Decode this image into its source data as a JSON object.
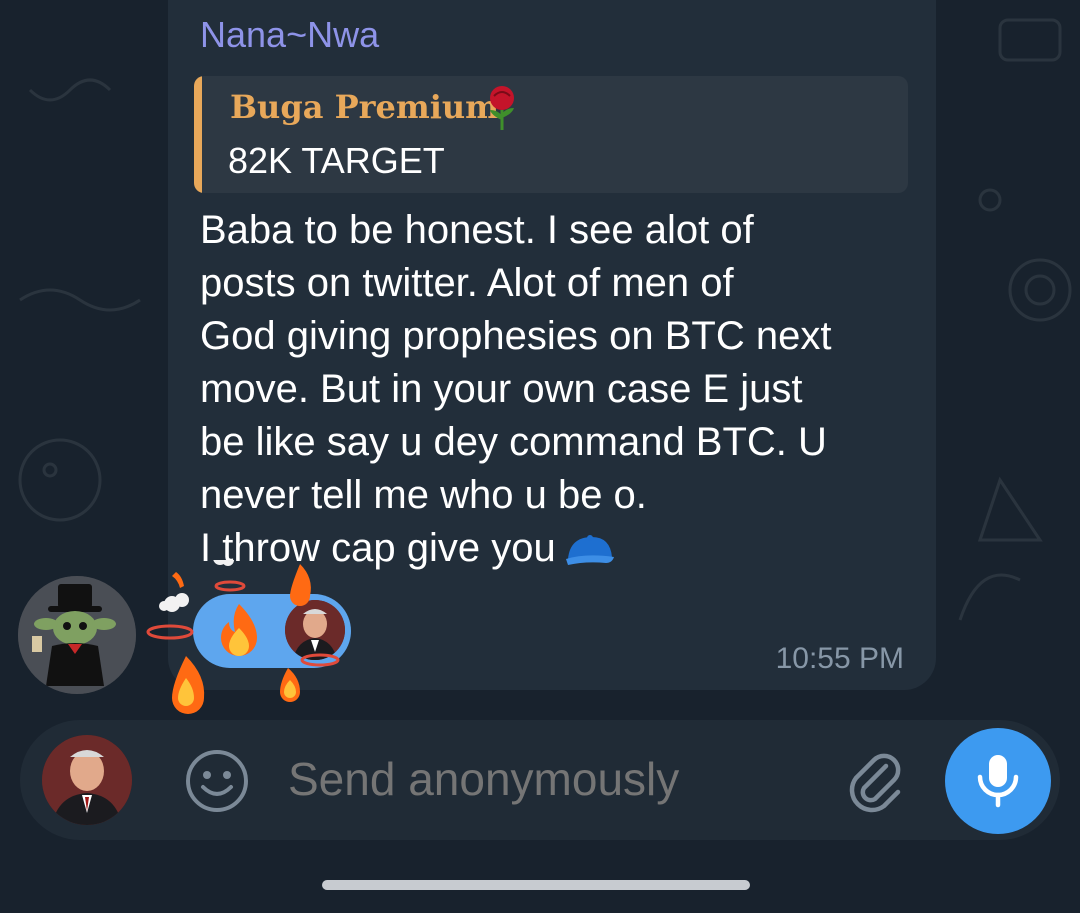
{
  "message": {
    "sender": "Nana~Nwa",
    "reply": {
      "author": "Buga Premium",
      "text": "82K TARGET"
    },
    "lines": [
      "Baba to be honest. I see alot of",
      "posts on twitter. Alot of men of",
      "God giving prophesies on BTC next",
      "move. But in your own case E just",
      "be like say u dey command BTC. U",
      "never tell me who u be o.",
      "I throw cap give you"
    ],
    "time": "10:55 PM",
    "reactions": [
      {
        "emoji": "fire-emoji",
        "reactor": "reactor-avatar"
      }
    ]
  },
  "input": {
    "placeholder": "Send anonymously"
  },
  "colors": {
    "background": "#18222d",
    "bubble": "#222e3a",
    "sender_name": "#8e93e8",
    "reply_accent": "#e8a85a",
    "reaction_pill": "#5ea6ee",
    "mic_button": "#3d9af0"
  }
}
